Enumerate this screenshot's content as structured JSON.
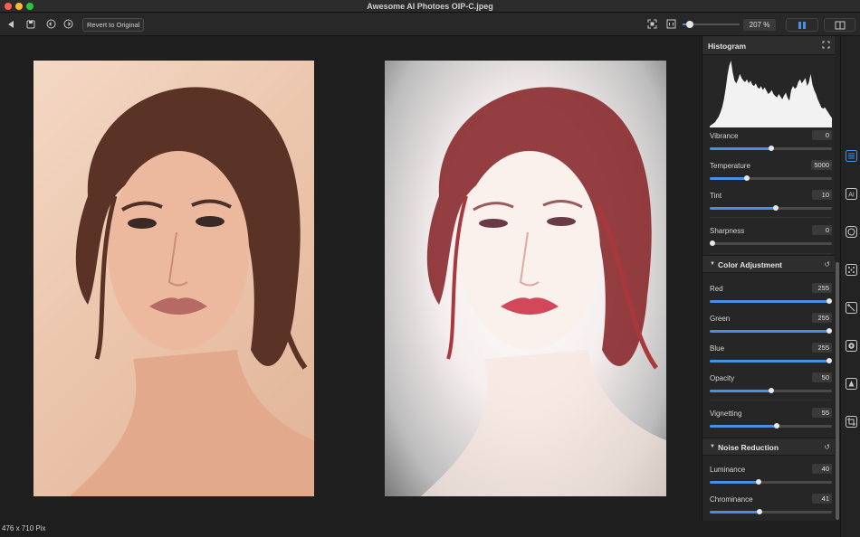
{
  "window": {
    "title": "Awesome AI Photoes   OIP-C.jpeg"
  },
  "toolbar": {
    "revert_label": "Revert to Original",
    "zoom_value": "207 %",
    "zoom_slider_level": 0.12
  },
  "canvas": {
    "image_size": "476 x 710 Pix"
  },
  "histogram": {
    "title": "Histogram",
    "levels": [
      0.02,
      0.04,
      0.06,
      0.08,
      0.12,
      0.16,
      0.22,
      0.3,
      0.42,
      0.58,
      0.78,
      0.92,
      1.0,
      0.82,
      0.7,
      0.66,
      0.72,
      0.8,
      0.74,
      0.7,
      0.68,
      0.72,
      0.66,
      0.7,
      0.64,
      0.62,
      0.66,
      0.6,
      0.58,
      0.62,
      0.56,
      0.6,
      0.55,
      0.5,
      0.52,
      0.56,
      0.5,
      0.47,
      0.45,
      0.5,
      0.46,
      0.42,
      0.48,
      0.52,
      0.44,
      0.4,
      0.56,
      0.62,
      0.58,
      0.6,
      0.68,
      0.72,
      0.66,
      0.7,
      0.74,
      0.62,
      0.68,
      0.8,
      0.64,
      0.56,
      0.5,
      0.42,
      0.36,
      0.3,
      0.28,
      0.3,
      0.26,
      0.22,
      0.18,
      0.14
    ]
  },
  "adjustments_top": [
    {
      "label": "Vibrance",
      "value": "0",
      "level": 0.5
    },
    {
      "label": "Temperature",
      "value": "5000",
      "level": 0.3
    },
    {
      "label": "Tint",
      "value": "10",
      "level": 0.54
    },
    {
      "label": "Sharpness",
      "value": "0",
      "level": 0.02
    }
  ],
  "color_adjustment": {
    "title": "Color Adjustment",
    "items": [
      {
        "label": "Red",
        "value": "255",
        "level": 0.98
      },
      {
        "label": "Green",
        "value": "255",
        "level": 0.98
      },
      {
        "label": "Blue",
        "value": "255",
        "level": 0.98
      },
      {
        "label": "Opacity",
        "value": "50",
        "level": 0.5
      },
      {
        "label": "Vignetting",
        "value": "55",
        "level": 0.55
      }
    ]
  },
  "noise_reduction": {
    "title": "Noise Reduction",
    "items": [
      {
        "label": "Luminance",
        "value": "40",
        "level": 0.4
      },
      {
        "label": "Chrominance",
        "value": "41",
        "level": 0.41
      }
    ]
  },
  "colors": {
    "accent": "#4a90e2",
    "background": "#1e1e1e",
    "panel": "#262626"
  },
  "icons": {
    "back": "back-arrow-icon",
    "save": "save-icon",
    "undo": "undo-icon",
    "redo": "redo-icon",
    "fit": "fit-screen-icon",
    "actual": "actual-size-icon",
    "expand": "expand-icon",
    "rail": [
      "adjustments-icon",
      "ai-icon",
      "filter-icon",
      "texture-icon",
      "magic-wand-icon",
      "settings-icon",
      "effects-icon",
      "crop-icon"
    ]
  }
}
